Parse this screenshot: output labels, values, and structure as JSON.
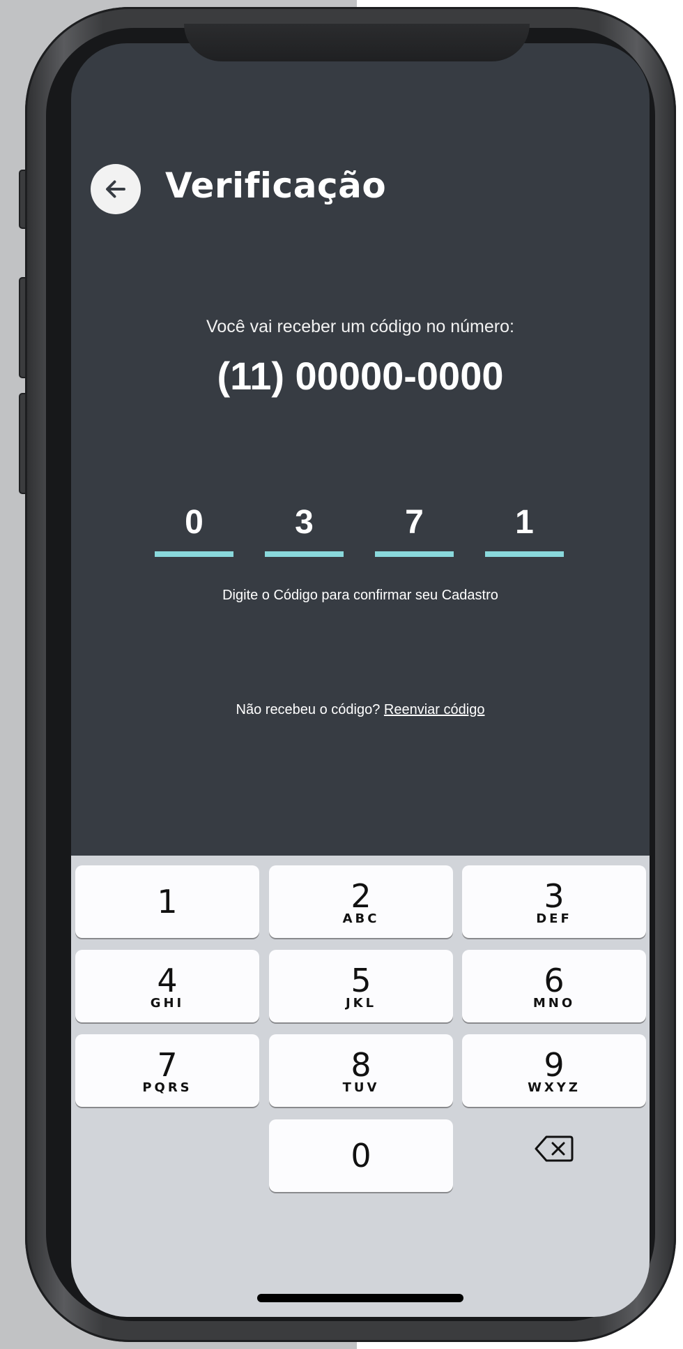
{
  "header": {
    "title": "Verificação",
    "back_icon": "arrow-left-icon"
  },
  "info": {
    "message": "Você vai receber um código no número:",
    "phone_number": "(11) 00000-0000"
  },
  "code": {
    "digits": [
      "0",
      "3",
      "7",
      "1"
    ],
    "hint": "Digite o Código para confirmar seu Cadastro"
  },
  "resend": {
    "question": "Não recebeu o código?",
    "link": "Reenviar código"
  },
  "keypad": {
    "keys": [
      {
        "num": "1",
        "letters": ""
      },
      {
        "num": "2",
        "letters": "ABC"
      },
      {
        "num": "3",
        "letters": "DEF"
      },
      {
        "num": "4",
        "letters": "GHI"
      },
      {
        "num": "5",
        "letters": "JKL"
      },
      {
        "num": "6",
        "letters": "MNO"
      },
      {
        "num": "7",
        "letters": "PQRS"
      },
      {
        "num": "8",
        "letters": "TUV"
      },
      {
        "num": "9",
        "letters": "WXYZ"
      },
      {
        "num": "0",
        "letters": ""
      }
    ],
    "delete_icon": "backspace-icon"
  },
  "colors": {
    "screen_bg": "#373c43",
    "underline_accent": "#8ad9dc",
    "keypad_bg": "#d1d4d9"
  }
}
